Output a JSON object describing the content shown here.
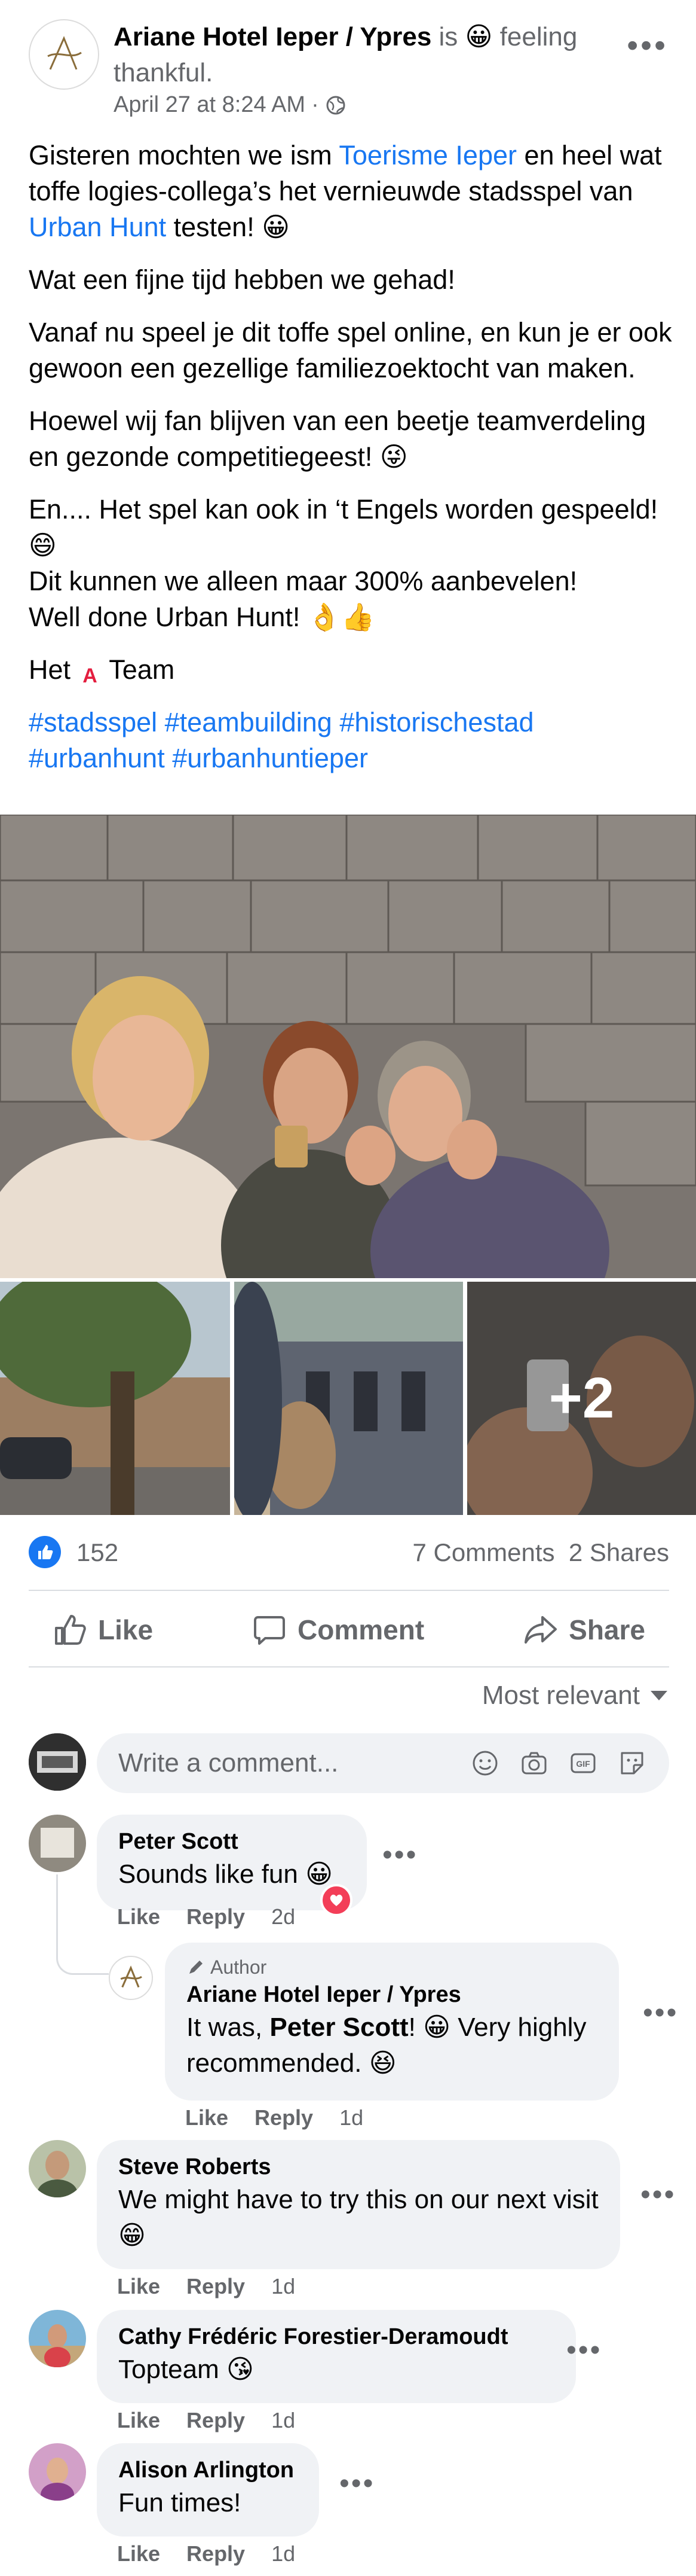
{
  "post": {
    "page_name": "Ariane Hotel Ieper / Ypres",
    "is_text": "is",
    "feeling_emoji": "😀",
    "feeling_text": "feeling thankful.",
    "timestamp": "April 27 at 8:24 AM",
    "separator": "·",
    "more": "•••",
    "body": {
      "p1_a": "Gisteren mochten we ism ",
      "p1_link1": "Toerisme Ieper",
      "p1_b": " en heel wat toffe logies-collega’s het vernieuwde stadsspel van ",
      "p1_link2": "Urban Hunt",
      "p1_c": " testen! 😀",
      "p2": "Wat een fijne tijd hebben we gehad!",
      "p3": "Vanaf nu speel je dit toffe spel online, en kun je er ook gewoon een gezellige familiezoektocht van maken.",
      "p4": "Hoewel wij fan blijven van een beetje teamverdeling en gezonde competitiegeest! 😜",
      "p5_line1": "En.... Het spel kan ook in ‘t Engels worden gespeeld! 😄",
      "p5_line2": "Dit kunnen we alleen maar 300% aanbevelen!",
      "p5_line3": "Well done Urban Hunt! 👌👍",
      "p6_a": "Het ",
      "p6_logo": "A",
      "p6_b": " Team",
      "hashtags": "#stadsspel #teambuilding #historischestad #urbanhunt #urbanhuntieper"
    },
    "photos": {
      "extra_count": "+2"
    },
    "reactions": {
      "count": "152",
      "comments": "7 Comments",
      "shares": "2 Shares"
    },
    "actions": {
      "like": "Like",
      "comment": "Comment",
      "share": "Share"
    },
    "sort": "Most relevant",
    "composer_placeholder": "Write a comment..."
  },
  "comments": [
    {
      "name": "Peter Scott",
      "text": "Sounds like fun 😀",
      "like": "Like",
      "reply": "Reply",
      "time": "2d"
    },
    {
      "author_tag": "Author",
      "name": "Ariane Hotel Ieper / Ypres",
      "text_a": "It was, ",
      "text_name": "Peter Scott",
      "text_b": "! 😀 Very highly recommended. 😆",
      "like": "Like",
      "reply": "Reply",
      "time": "1d"
    },
    {
      "name": "Steve Roberts",
      "text": "We might have to try this on our next visit 😁",
      "like": "Like",
      "reply": "Reply",
      "time": "1d"
    },
    {
      "name": "Cathy Frédéric Forestier-Deramoudt",
      "text": "Topteam 😘",
      "like": "Like",
      "reply": "Reply",
      "time": "1d"
    },
    {
      "name": "Alison Arlington",
      "text": "Fun times!",
      "like": "Like",
      "reply": "Reply",
      "time": "1d"
    }
  ],
  "colors": {
    "link": "#1877f2",
    "muted": "#65676b",
    "bubble": "#f0f2f5",
    "heart": "#f33e58"
  }
}
